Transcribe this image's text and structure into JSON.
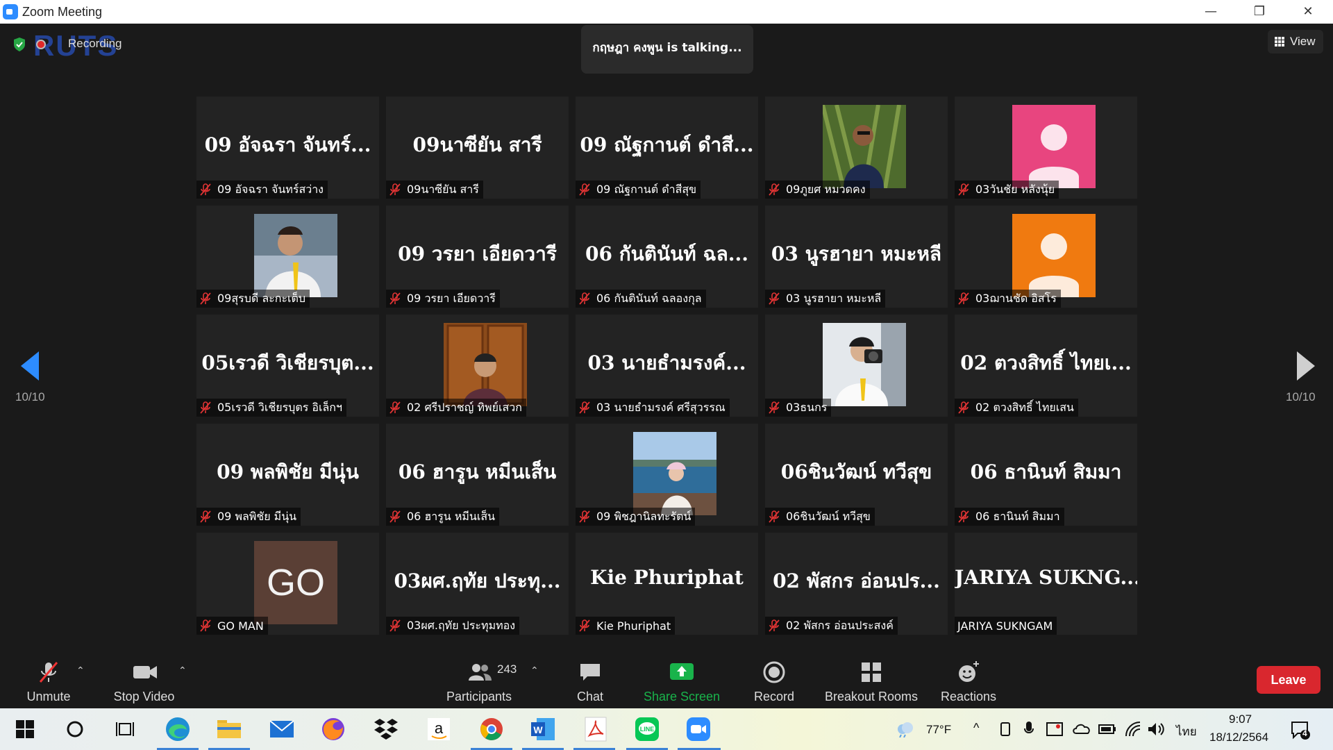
{
  "window": {
    "title": "Zoom Meeting",
    "minimize": "—",
    "restore": "❐",
    "close": "✕"
  },
  "meeting": {
    "recording_label": "Recording",
    "logo_overlay_text": "RUTS",
    "talking_banner": "กฤษฎา คงพูน is talking...",
    "view_label": "View",
    "page_left": "10/10",
    "page_right": "10/10"
  },
  "tiles": [
    {
      "big": "09 อัจฉรา จันทร์...",
      "name": "09 อัจฉรา จันทร์สว่าง",
      "muted": true
    },
    {
      "big": "09นาซียัน สารี",
      "name": "09นาซียัน สารี",
      "muted": true
    },
    {
      "big": "09 ณัฐกานต์ ดำสี...",
      "name": "09 ณัฐกานต์ ดำสีสุข",
      "muted": true
    },
    {
      "photo": "palm-photo",
      "name": "09ภูยศ หมวดคง",
      "muted": true
    },
    {
      "avatar": "pink",
      "name": "03วันชัย หลังนุ้ย",
      "muted": true
    },
    {
      "photo": "shirt-photo",
      "name": "09สุรบดี ละกะเต็บ",
      "muted": true
    },
    {
      "big": "09 วรยา เอียดวารี",
      "name": "09 วรยา เอียดวารี",
      "muted": true
    },
    {
      "big": "06 กันตินันท์ ฉล...",
      "name": "06 กันตินันท์ ฉลองกุล",
      "muted": true
    },
    {
      "big": "03 นูรฮายา หมะหลี",
      "name": "03 นูรฮายา หมะหลี",
      "muted": true
    },
    {
      "avatar": "orange",
      "name": "03ฌานชัด อิสโร",
      "muted": true
    },
    {
      "big": "05เรวดี วิเชียรบุต...",
      "name": "05เรวดี วิเชียรบุตร อิเล็กฯ",
      "muted": true
    },
    {
      "photo": "door-photo",
      "name": "02 ศรีปราชญ์ ทิพย์เสวก",
      "muted": true
    },
    {
      "big": "03 นายธำมรงค์...",
      "name": "03 นายธำมรงค์  ศรีสุวรรณ",
      "muted": true
    },
    {
      "photo": "camera-photo",
      "name": "03ธนกร",
      "muted": true
    },
    {
      "big": "02 ตวงสิทธิ์ ไทยเ...",
      "name": "02 ตวงสิทธิ์ ไทยเสน",
      "muted": true
    },
    {
      "big": "09 พลพิชัย มีนุ่น",
      "name": "09 พลพิชัย มีนุ่น",
      "muted": true
    },
    {
      "big": "06 ฮารูน หมีนเส็น",
      "name": "06 ฮารูน หมีนเส็น",
      "muted": true
    },
    {
      "photo": "sea-photo",
      "name": "09 พิชฎานิลทะรัตน์",
      "muted": true
    },
    {
      "big": "06ชินวัฒน์ ทวีสุข",
      "name": "06ชินวัฒน์ ทวีสุข",
      "muted": true
    },
    {
      "big": "06 ธานินท์ สิมมา",
      "name": "06 ธานินท์ สิมมา",
      "muted": true
    },
    {
      "go": "GO",
      "name": "GO MAN",
      "muted": true
    },
    {
      "big": "03ผศ.ฤทัย ประทุ...",
      "name": "03ผศ.ฤทัย ประทุมทอง",
      "muted": true
    },
    {
      "big": "Kie Phuriphat",
      "name": "Kie Phuriphat",
      "muted": true
    },
    {
      "big": "02 พัสกร อ่อนปร...",
      "name": "02 พัสกร อ่อนประสงค์",
      "muted": true
    },
    {
      "big": "JARIYA  SUKNG...",
      "name": "JARIYA SUKNGAM",
      "muted": false
    }
  ],
  "toolbar": {
    "unmute": "Unmute",
    "stop_video": "Stop Video",
    "participants_count": "243",
    "participants": "Participants",
    "chat": "Chat",
    "share_screen": "Share Screen",
    "record": "Record",
    "breakout_rooms": "Breakout Rooms",
    "reactions": "Reactions",
    "leave": "Leave",
    "share_color": "#19b34b",
    "leave_color": "#d9272e"
  },
  "taskbar": {
    "weather": "77°F",
    "language": "ไทย",
    "time": "9:07",
    "date": "18/12/2564",
    "notifications": "4"
  }
}
